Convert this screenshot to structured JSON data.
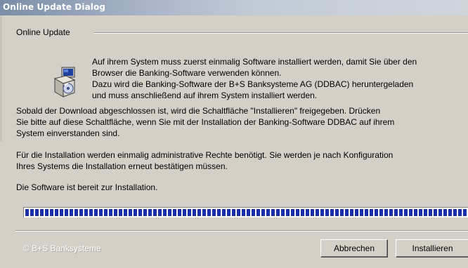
{
  "window": {
    "title": "Online Update Dialog"
  },
  "group": {
    "label": "Online Update"
  },
  "intro": {
    "line1": "Auf ihrem System muss zuerst einmalig Software installiert werden, damit Sie über den",
    "line2": "Browser die Banking-Software verwenden können.",
    "line3": "Dazu wird die Banking-Software der B+S Banksysteme AG (DDBAC) heruntergeladen",
    "line4": "und muss anschließend auf ihrem System installiert werden."
  },
  "para_download": {
    "line1": "Sobald der Download abgeschlossen ist, wird die Schaltfläche \"Installieren\" freigegeben. Drücken",
    "line2": "Sie bitte auf diese Schaltfläche, wenn Sie mit der Installation der Banking-Software DDBAC auf ihrem",
    "line3": "System einverstanden sind."
  },
  "para_rights": {
    "line1": "Für die Installation werden einmalig administrative Rechte benötigt. Sie werden je nach Konfiguration",
    "line2": "Ihres Systems die Installation erneut bestätigen müssen."
  },
  "status": {
    "text": "Die Software ist bereit zur Installation."
  },
  "progress": {
    "percent": 100
  },
  "footer": {
    "copyright": "© B+S Banksysteme"
  },
  "buttons": {
    "cancel": "Abbrechen",
    "install": "Installieren"
  },
  "icons": {
    "setup": "software-setup-icon"
  },
  "colors": {
    "dialog_bg": "#d4d0c8",
    "progress_blocks": "#1a2fa6",
    "titlebar_start": "#7b8da6"
  }
}
